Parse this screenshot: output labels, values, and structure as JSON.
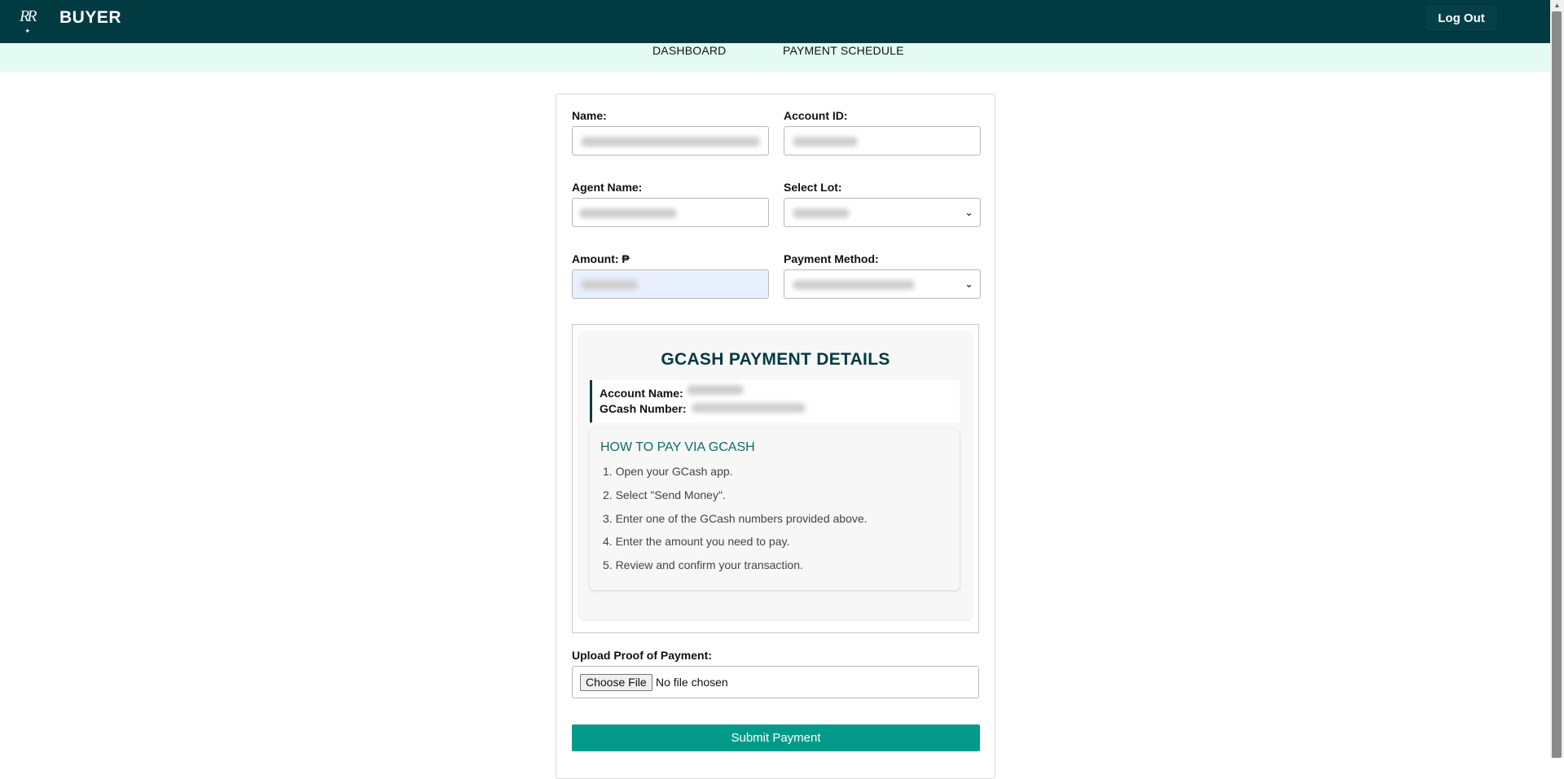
{
  "header": {
    "logo_text": "RR",
    "title": "BUYER",
    "logout_label": "Log Out"
  },
  "nav": {
    "dashboard": "DASHBOARD",
    "payment_schedule": "PAYMENT SCHEDULE"
  },
  "form": {
    "name_label": "Name:",
    "account_id_label": "Account ID:",
    "agent_name_label": "Agent Name:",
    "select_lot_label": "Select Lot:",
    "amount_label": "Amount: ₱",
    "payment_method_label": "Payment Method:",
    "upload_label": "Upload Proof of Payment:",
    "choose_file_label": "Choose File",
    "no_file_text": "No file chosen",
    "submit_label": "Submit Payment"
  },
  "gcash": {
    "title": "GCASH PAYMENT DETAILS",
    "account_name_label": "Account Name:",
    "gcash_number_label": "GCash Number:",
    "howto_title": "HOW TO PAY VIA GCASH",
    "steps": [
      "1. Open your GCash app.",
      "2. Select \"Send Money\".",
      "3. Enter one of the GCash numbers provided above.",
      "4. Enter the amount you need to pay.",
      "5. Review and confirm your transaction."
    ]
  },
  "colors": {
    "header_bg": "#023a42",
    "nav_bg": "#e3fbf3",
    "accent": "#049a8b",
    "title_color": "#023a42"
  }
}
